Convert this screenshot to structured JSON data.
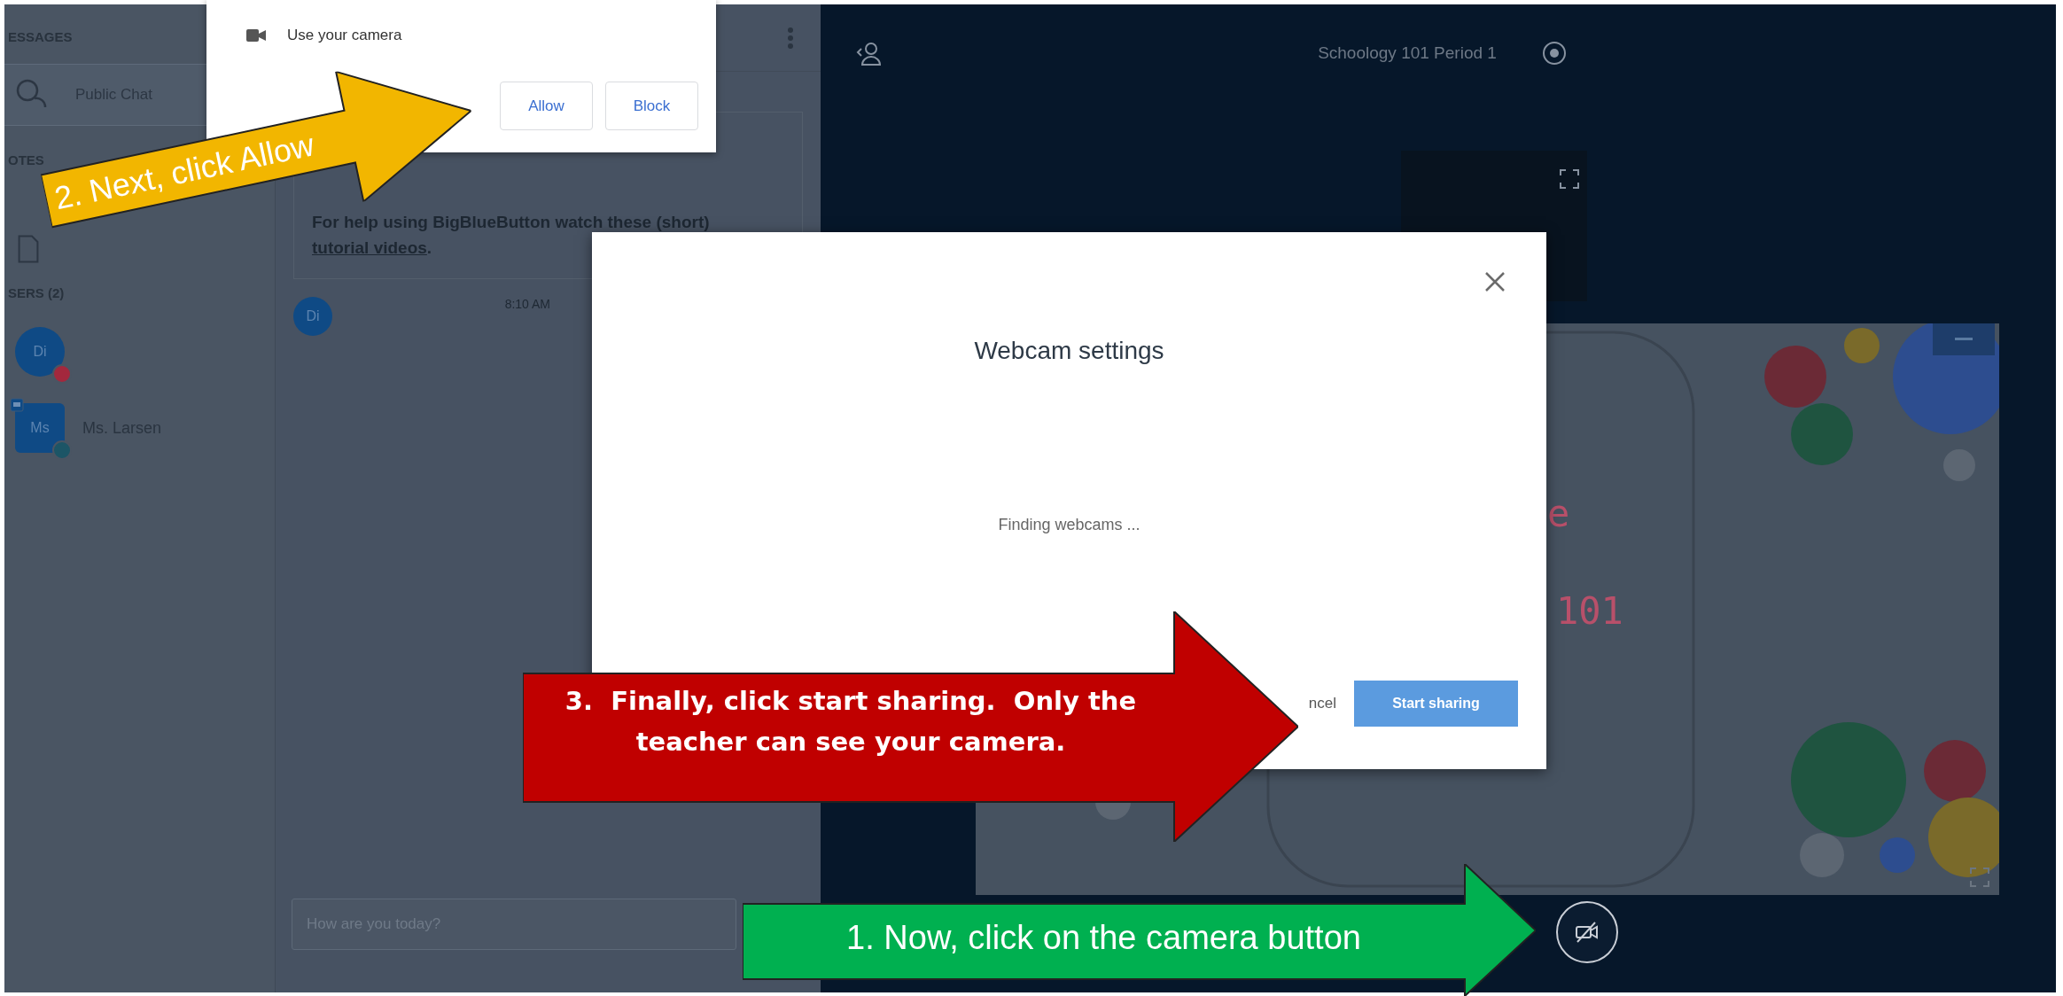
{
  "sidebar": {
    "messages_heading": "ESSAGES",
    "chats": [
      {
        "label": "Public Chat",
        "selected": true
      }
    ],
    "notes_heading": "OTES",
    "users_heading": "SERS (2)",
    "users": [
      {
        "initials": "Di",
        "kind": "viewer",
        "color": "#a3283d"
      },
      {
        "initials": "Ms",
        "name": "Ms. Larsen",
        "kind": "moderator",
        "color": "#1c5566"
      }
    ]
  },
  "chat": {
    "welcome": "For help using BigBlueButton watch these (short)",
    "welcome_link": "tutorial videos",
    "welcome_end": ".",
    "messages": [
      {
        "initials": "Di",
        "time": "8:10 AM"
      }
    ],
    "input": {
      "placeholder": "How are you today?"
    }
  },
  "main": {
    "title": "Schoology 101 Period 1",
    "slide_texts": [
      "e",
      "101"
    ]
  },
  "permission_popup": {
    "request": "Use your camera",
    "buttons": [
      "Allow",
      "Block"
    ]
  },
  "modal": {
    "title": "Webcam settings",
    "status": "Finding webcams ...",
    "cancel": "ncel",
    "confirm": "Start sharing"
  },
  "callouts": [
    {
      "text": "2. Next, click Allow",
      "color": "#f2b600"
    },
    {
      "text": "3.  Finally, click start sharing.  Only the teacher can see your camera.",
      "color": "#c00000"
    },
    {
      "text": "1. Now, click on the camera button",
      "color": "#00b050"
    }
  ]
}
